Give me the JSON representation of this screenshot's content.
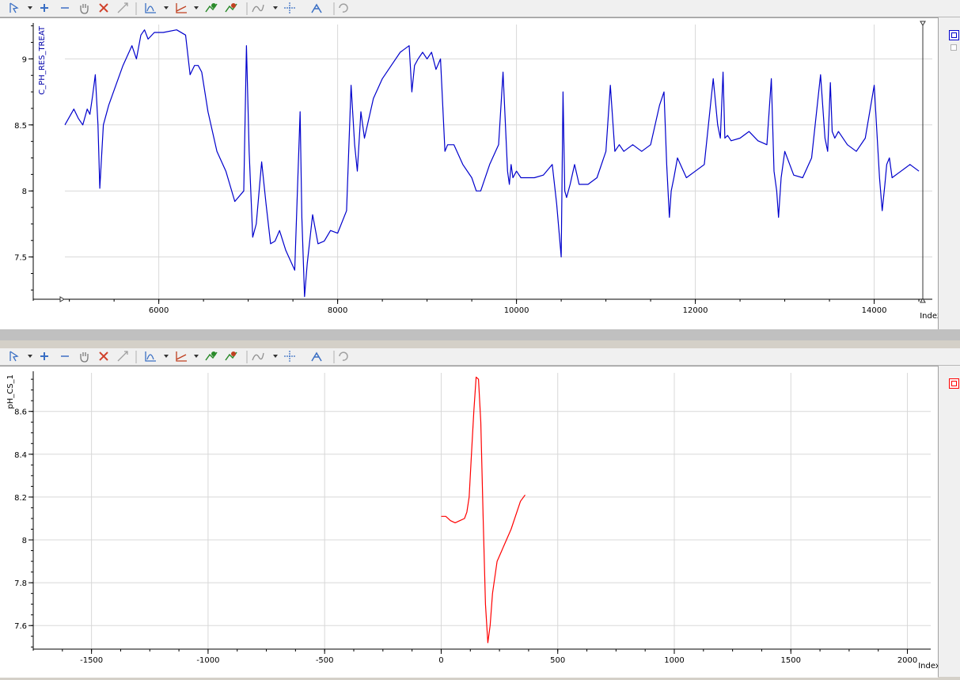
{
  "toolbar": {
    "icons": [
      "select-cursor-icon",
      "zoom-in-icon",
      "zoom-out-icon",
      "pan-hand-icon",
      "delete-x-icon",
      "fit-icon",
      "chart-type-icon",
      "axis-icon",
      "series-add-icon",
      "series-remove-icon",
      "smooth-icon",
      "crosshair-icon",
      "marker-icon",
      "undo-icon"
    ]
  },
  "chart_data": [
    {
      "type": "line",
      "ylabel": "C_PH_RES_TREAT",
      "xlabel": "Index",
      "xlim": [
        4950,
        14650
      ],
      "ylim": [
        7.18,
        9.26
      ],
      "xticks": [
        6000,
        8000,
        10000,
        12000,
        14000
      ],
      "yticks": [
        7.5,
        8,
        8.5,
        9
      ],
      "ytick_labels": [
        "7.5",
        "8",
        "8.5",
        "9"
      ],
      "color": "#0000cc",
      "grid": true,
      "x": [
        4950,
        5050,
        5100,
        5150,
        5200,
        5230,
        5260,
        5290,
        5320,
        5340,
        5380,
        5440,
        5520,
        5600,
        5700,
        5750,
        5800,
        5840,
        5880,
        5950,
        6050,
        6200,
        6300,
        6350,
        6400,
        6440,
        6480,
        6550,
        6650,
        6750,
        6850,
        6950,
        6980,
        7010,
        7050,
        7090,
        7150,
        7200,
        7250,
        7300,
        7350,
        7420,
        7520,
        7580,
        7600,
        7630,
        7660,
        7720,
        7780,
        7850,
        7920,
        8000,
        8100,
        8150,
        8190,
        8220,
        8260,
        8300,
        8400,
        8500,
        8600,
        8700,
        8800,
        8830,
        8860,
        8900,
        8950,
        9000,
        9050,
        9100,
        9150,
        9200,
        9230,
        9300,
        9400,
        9500,
        9550,
        9600,
        9700,
        9800,
        9850,
        9900,
        9920,
        9940,
        9960,
        10000,
        10050,
        10100,
        10200,
        10300,
        10400,
        10450,
        10500,
        10520,
        10540,
        10560,
        10600,
        10650,
        10700,
        10800,
        10900,
        11000,
        11050,
        11100,
        11150,
        11200,
        11300,
        11400,
        11500,
        11600,
        11650,
        11680,
        11710,
        11730,
        11760,
        11800,
        11900,
        12000,
        12100,
        12200,
        12250,
        12280,
        12310,
        12330,
        12360,
        12400,
        12500,
        12600,
        12700,
        12800,
        12850,
        12880,
        12910,
        12930,
        12960,
        13000,
        13100,
        13200,
        13300,
        13400,
        13450,
        13480,
        13510,
        13530,
        13560,
        13600,
        13700,
        13800,
        13900,
        14000,
        14060,
        14090,
        14120,
        14140,
        14170,
        14200,
        14300,
        14400,
        14500,
        14600
      ],
      "y": [
        8.5,
        8.62,
        8.55,
        8.5,
        8.62,
        8.58,
        8.72,
        8.88,
        8.5,
        8.02,
        8.5,
        8.65,
        8.8,
        8.95,
        9.1,
        9.0,
        9.18,
        9.22,
        9.15,
        9.2,
        9.2,
        9.22,
        9.18,
        8.88,
        8.95,
        8.95,
        8.9,
        8.6,
        8.3,
        8.15,
        7.92,
        8.0,
        9.1,
        8.3,
        7.65,
        7.75,
        8.22,
        7.9,
        7.6,
        7.62,
        7.7,
        7.55,
        7.4,
        8.6,
        7.8,
        7.2,
        7.45,
        7.82,
        7.6,
        7.62,
        7.7,
        7.68,
        7.85,
        8.8,
        8.35,
        8.15,
        8.6,
        8.4,
        8.7,
        8.85,
        8.95,
        9.05,
        9.1,
        8.75,
        8.95,
        9.0,
        9.05,
        9.0,
        9.05,
        8.92,
        9.0,
        8.3,
        8.35,
        8.35,
        8.2,
        8.1,
        8.0,
        8.0,
        8.2,
        8.35,
        8.9,
        8.15,
        8.05,
        8.2,
        8.1,
        8.15,
        8.1,
        8.1,
        8.1,
        8.12,
        8.2,
        7.9,
        7.5,
        8.75,
        8.0,
        7.95,
        8.05,
        8.2,
        8.05,
        8.05,
        8.1,
        8.3,
        8.8,
        8.3,
        8.35,
        8.3,
        8.35,
        8.3,
        8.35,
        8.65,
        8.75,
        8.2,
        7.8,
        8.0,
        8.1,
        8.25,
        8.1,
        8.15,
        8.2,
        8.85,
        8.5,
        8.4,
        8.9,
        8.4,
        8.42,
        8.38,
        8.4,
        8.45,
        8.38,
        8.35,
        8.85,
        8.15,
        8.0,
        7.8,
        8.1,
        8.3,
        8.12,
        8.1,
        8.25,
        8.88,
        8.4,
        8.3,
        8.82,
        8.45,
        8.4,
        8.45,
        8.35,
        8.3,
        8.4,
        8.8,
        8.1,
        7.85,
        8.05,
        8.2,
        8.25,
        8.1,
        8.15,
        8.2,
        8.15
      ]
    },
    {
      "type": "line",
      "ylabel": "pH_CS_1",
      "xlabel": "Index",
      "xlim": [
        -1750,
        2100
      ],
      "ylim": [
        7.49,
        8.78
      ],
      "xticks": [
        -1500,
        -1000,
        -500,
        0,
        500,
        1000,
        1500,
        2000
      ],
      "yticks": [
        7.6,
        7.8,
        8,
        8.2,
        8.4,
        8.6
      ],
      "ytick_labels": [
        "7.6",
        "7.8",
        "8",
        "8.2",
        "8.4",
        "8.6"
      ],
      "color": "#ff0000",
      "grid": true,
      "x": [
        0,
        20,
        40,
        60,
        80,
        100,
        110,
        120,
        130,
        140,
        150,
        160,
        170,
        180,
        190,
        200,
        210,
        220,
        240,
        260,
        300,
        340,
        360
      ],
      "y": [
        8.11,
        8.11,
        8.09,
        8.08,
        8.09,
        8.1,
        8.13,
        8.2,
        8.4,
        8.6,
        8.76,
        8.75,
        8.55,
        8.1,
        7.7,
        7.52,
        7.6,
        7.75,
        7.9,
        7.95,
        8.05,
        8.18,
        8.21
      ]
    }
  ]
}
